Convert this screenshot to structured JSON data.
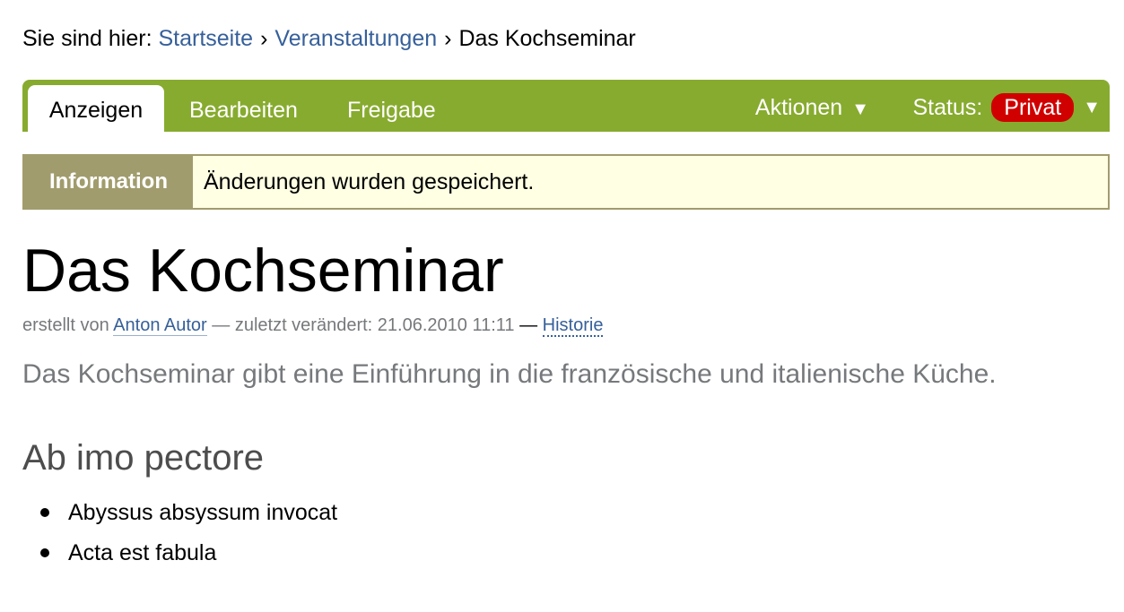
{
  "breadcrumb": {
    "prefix": "Sie sind hier:",
    "items": [
      {
        "label": "Startseite"
      },
      {
        "label": "Veranstaltungen"
      },
      {
        "label": "Das Kochseminar"
      }
    ],
    "separator": "›"
  },
  "toolbar": {
    "tabs": [
      {
        "label": "Anzeigen",
        "active": true
      },
      {
        "label": "Bearbeiten",
        "active": false
      },
      {
        "label": "Freigabe",
        "active": false
      }
    ],
    "actions_label": "Aktionen",
    "status_label": "Status:",
    "status_value": "Privat",
    "arrow_glyph": "▼",
    "colors": {
      "bar": "#87ab2f",
      "status_badge": "#d10000"
    }
  },
  "notice": {
    "label": "Information",
    "message": "Änderungen wurden gespeichert."
  },
  "page": {
    "title": "Das Kochseminar",
    "byline": {
      "created_by": "erstellt von",
      "author": "Anton Autor",
      "modified_label": "— zuletzt verändert: 21.06.2010 11:11",
      "dash": "—",
      "history": "Historie"
    },
    "description": "Das Kochseminar gibt eine Einführung in die französische und italienische Küche.",
    "section_heading": "Ab imo pectore",
    "list_items": [
      "Abyssus absyssum invocat",
      "Acta est fabula"
    ]
  }
}
